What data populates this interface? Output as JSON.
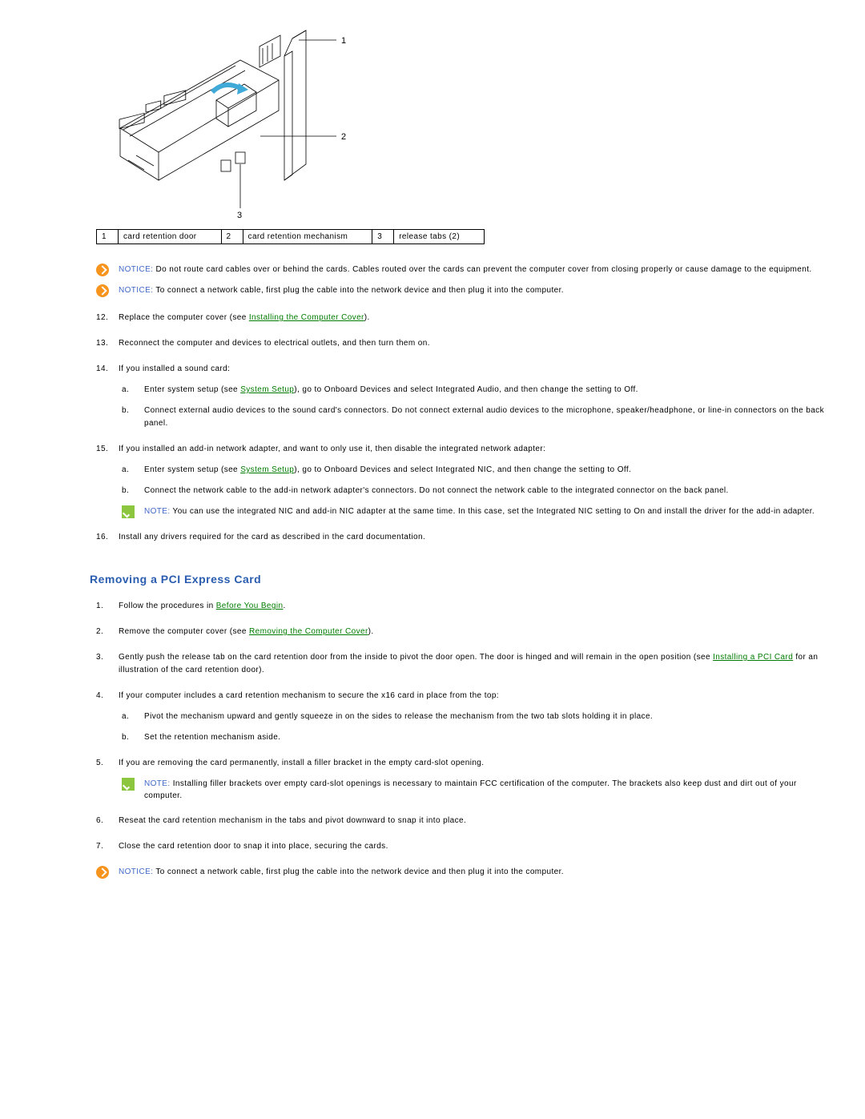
{
  "diagram": {
    "callout1": "1",
    "callout2": "2",
    "callout3": "3"
  },
  "legend": {
    "c1n": "1",
    "c1t": "card retention door",
    "c2n": "2",
    "c2t": "card retention mechanism",
    "c3n": "3",
    "c3t": "release tabs (2)"
  },
  "noticeA": {
    "label": "NOTICE:",
    "text": " Do not route card cables over or behind the cards. Cables routed over the cards can prevent the computer cover from closing properly or cause damage to the equipment."
  },
  "noticeB": {
    "label": "NOTICE:",
    "text": " To connect a network cable, first plug the cable into the network device and then plug it into the computer."
  },
  "step12_a": "Replace the computer cover (see ",
  "step12_link": "Installing the Computer Cover",
  "step12_b": ").",
  "step13": "Reconnect the computer and devices to electrical outlets, and then turn them on.",
  "step14": "If you installed a sound card:",
  "s14a_a": "Enter system setup (see ",
  "s14a_link": "System Setup",
  "s14a_b": "), go to Onboard Devices and select Integrated Audio, and then change the setting to Off.",
  "s14b": "Connect external audio devices to the sound card's connectors. Do not connect external audio devices to the microphone, speaker/headphone, or line-in connectors on the back panel.",
  "step15": "If you installed an add-in network adapter, and want to only use it, then disable the integrated network adapter:",
  "s15a_a": "Enter system setup (see ",
  "s15a_link": "System Setup",
  "s15a_b": "), go to Onboard Devices and select Integrated NIC, and then change the setting to Off.",
  "s15b": "Connect the network cable to the add-in network adapter's connectors. Do not connect the network cable to the integrated connector on the back panel.",
  "note15": {
    "label": "NOTE:",
    "text": " You can use the integrated NIC and add-in NIC adapter at the same time. In this case, set the Integrated NIC setting to On and install the driver for the add-in adapter."
  },
  "step16": "Install any drivers required for the card as described in the card documentation.",
  "sectionTitle": "Removing a PCI Express Card",
  "r1_a": "Follow the procedures in ",
  "r1_link": "Before You Begin",
  "r1_b": ".",
  "r2_a": "Remove the computer cover (see ",
  "r2_link": "Removing the Computer Cover",
  "r2_b": ").",
  "r3_a": "Gently push the release tab on the card retention door from the inside to pivot the door open. The door is hinged and will remain in the open position (see ",
  "r3_link": "Installing a PCI Card",
  "r3_b": " for an illustration of the card retention door).",
  "r4": "If your computer includes a card retention mechanism to secure the x16 card in place from the top:",
  "r4a": "Pivot the mechanism upward and gently squeeze in on the sides to release the mechanism from the two tab slots holding it in place.",
  "r4b": "Set the retention mechanism aside.",
  "r5": "If you are removing the card permanently, install a filler bracket in the empty card-slot opening.",
  "noteR5": {
    "label": "NOTE:",
    "text": " Installing filler brackets over empty card-slot openings is necessary to maintain FCC certification of the computer. The brackets also keep dust and dirt out of your computer."
  },
  "r6": "Reseat the card retention mechanism in the tabs and pivot downward to snap it into place.",
  "r7": "Close the card retention door to snap it into place, securing the cards.",
  "noticeEnd": {
    "label": "NOTICE:",
    "text": " To connect a network cable, first plug the cable into the network device and then plug it into the computer."
  }
}
